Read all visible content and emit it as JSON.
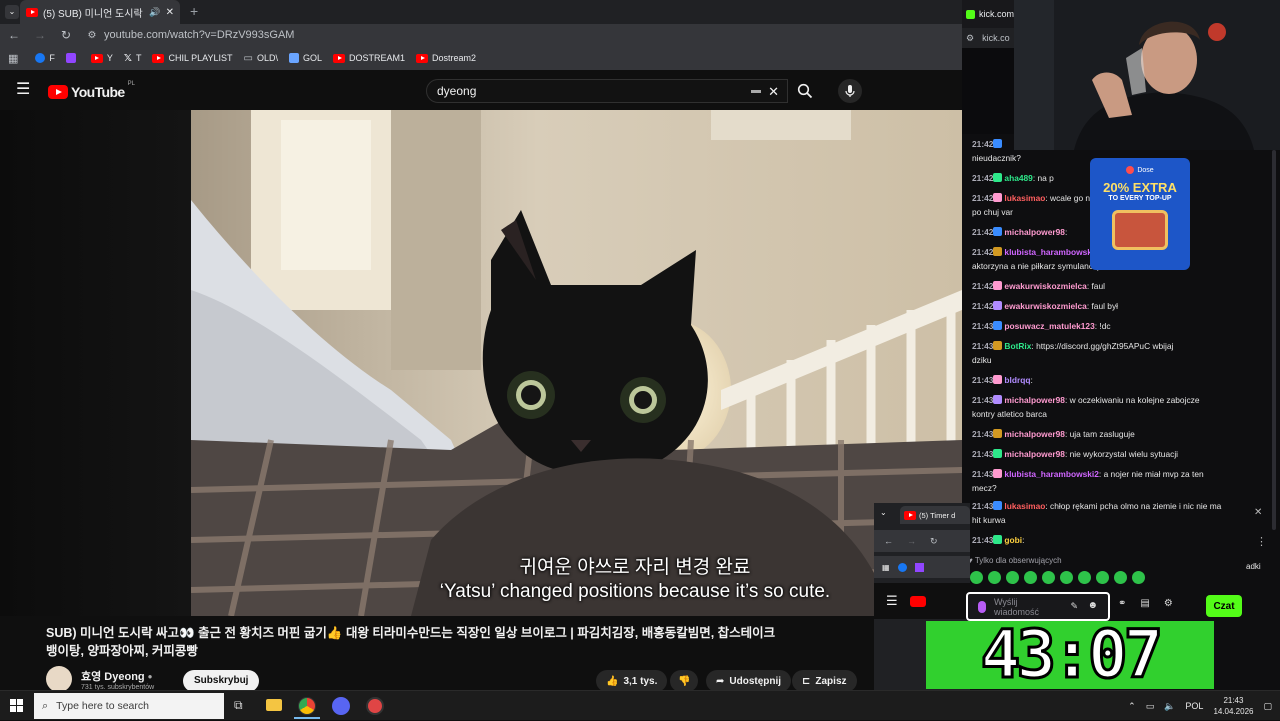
{
  "browser": {
    "tab_title": "(5) SUB) 미니언 도시락 싸고",
    "url": "youtube.com/watch?v=DRzV993sGAM",
    "bookmarks": [
      {
        "label": "F",
        "color": "#1877f2"
      },
      {
        "label": "",
        "color": "#9146ff"
      },
      {
        "label": "Y",
        "color": "#ff0000"
      },
      {
        "label": "T",
        "color": "#000000"
      },
      {
        "label": "CHIL PLAYLIST",
        "color": "#ff0000"
      },
      {
        "label": "OLD\\",
        "color": "#bdc1c6"
      },
      {
        "label": "GOL",
        "color": "#6aa5ff"
      },
      {
        "label": "DOSTREAM1",
        "color": "#ff0000"
      },
      {
        "label": "Dostream2",
        "color": "#ff0000"
      }
    ]
  },
  "youtube": {
    "logo_text": "YouTube",
    "region": "PL",
    "search_value": "dyeong",
    "subtitle_korean": "귀여운 야쓰로 자리 변경 완료",
    "subtitle_english": "‘Yatsu’ changed positions because it’s so cute.",
    "video_title_line1": "SUB) 미니언 도시락 싸고👀 출근 전 황치즈 머핀 굽기👍 대왕 티라미수만드는 직장인 일상 브이로그 | 파김치김장, 배홍동칼빔면, 찹스테이크",
    "video_title_line2": "뱅이탕, 양파장아찌, 커피콩빵",
    "channel_name": "효영 Dyeong",
    "subscribers": "731 tys. subskrybentów",
    "subscribe_label": "Subskrybuj",
    "likes": "3,1 tys.",
    "share_label": "Udostępnij",
    "save_label": "Zapisz"
  },
  "stream": {
    "kick_tab": "kick.com/",
    "kick_url": "kick.co",
    "chat": [
      {
        "time": "21:42",
        "user": "",
        "user_color": "#ffffff",
        "text": ""
      },
      {
        "time": "",
        "user": "",
        "user_color": "#ffffff",
        "text": "nieudacznik?"
      },
      {
        "time": "21:42",
        "user": "aha489",
        "user_color": "#2ee88a",
        "text": ": na p"
      },
      {
        "time": "21:42",
        "user": "lukasimao",
        "user_color": "#ff5f5f",
        "text": ": wcale go na"
      },
      {
        "time": "",
        "user": "",
        "user_color": "#ffffff",
        "text": "po chuj var"
      },
      {
        "time": "21:42",
        "user": "michalpower98",
        "user_color": "#ff9bd0",
        "text": ":"
      },
      {
        "time": "21:42",
        "user": "klubista_harambowski2",
        "user_color": "#d066ff",
        "text": " jak buskest"
      },
      {
        "time": "",
        "user": "",
        "user_color": "#ffffff",
        "text": "aktorzyna a nie piłkarz symulanci j"
      },
      {
        "time": "21:42",
        "user": "ewakurwiskozmielca",
        "user_color": "#ff9bd0",
        "text": ": faul"
      },
      {
        "time": "21:42",
        "user": "ewakurwiskozmielca",
        "user_color": "#ff9bd0",
        "text": ": faul był"
      },
      {
        "time": "21:43",
        "user": "posuwacz_matulek123",
        "user_color": "#ff9bd0",
        "text": ": !dc"
      },
      {
        "time": "21:43",
        "user": "BotRix",
        "user_color": "#2ee88a",
        "text": ": https://discord.gg/ghZt95APuC wbijaj"
      },
      {
        "time": "",
        "user": "",
        "user_color": "#ffffff",
        "text": "dziku"
      },
      {
        "time": "21:43",
        "user": "bldrqq",
        "user_color": "#b18cff",
        "text": ":"
      },
      {
        "time": "21:43",
        "user": "michalpower98",
        "user_color": "#ff9bd0",
        "text": ": w oczekiwaniu na kolejne zabojcze"
      },
      {
        "time": "",
        "user": "",
        "user_color": "#ffffff",
        "text": "kontry atletico barca"
      },
      {
        "time": "21:43",
        "user": "michalpower98",
        "user_color": "#ff9bd0",
        "text": ": uja tam zasluguje"
      },
      {
        "time": "21:43",
        "user": "michalpower98",
        "user_color": "#ff9bd0",
        "text": ": nie wykorzystal wielu sytuacji"
      },
      {
        "time": "21:43",
        "user": "klubista_harambowski2",
        "user_color": "#d066ff",
        "text": ": a nojer nie miał mvp za ten"
      },
      {
        "time": "",
        "user": "",
        "user_color": "#ffffff",
        "text": "mecz?"
      },
      {
        "time": "21:43",
        "user": "lukasimao",
        "user_color": "#ff5f5f",
        "text": ": chłop rękami pcha olmo na ziemie i nic nie ma"
      },
      {
        "time": "",
        "user": "",
        "user_color": "#ffffff",
        "text": "hit kurwa"
      },
      {
        "time": "21:43",
        "user": "gobi",
        "user_color": "#ffd23f",
        "text": ":"
      }
    ],
    "ad_brand": "Dose",
    "ad_headline": "20% EXTRA",
    "ad_sub": "TO EVERY TOP-UP",
    "followers_only": "Tylko dla obserwujących",
    "chat_placeholder_line1": "Wyślij",
    "chat_placeholder_line2": "wiadomość",
    "chat_button": "Czat",
    "mini_tab": "(5) Timer d",
    "mini_side": "adki",
    "timer": "43:07"
  },
  "taskbar": {
    "search_placeholder": "Type here to search",
    "language": "POL",
    "time": "21:43",
    "date": "14.04.2026"
  }
}
